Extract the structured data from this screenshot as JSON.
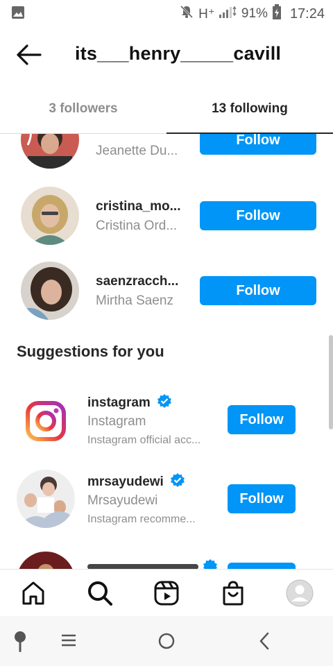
{
  "status_bar": {
    "network": "H⁺",
    "battery": "91%",
    "time": "17:24",
    "icons": [
      "image-icon",
      "mute-icon",
      "signal-icon",
      "battery-icon"
    ]
  },
  "header": {
    "title": "its___henry_____cavill",
    "back_icon": "arrow-left-icon"
  },
  "tabs": [
    {
      "label": "3 followers",
      "active": false
    },
    {
      "label": "13 following",
      "active": true
    }
  ],
  "following": [
    {
      "username": "",
      "name": "Jeanette Du...",
      "button": "Follow"
    },
    {
      "username": "cristina_mo...",
      "name": "Cristina Ord...",
      "button": "Follow"
    },
    {
      "username": "saenzracch...",
      "name": "Mirtha Saenz",
      "button": "Follow"
    }
  ],
  "suggestions": {
    "title": "Suggestions for you",
    "items": [
      {
        "username": "instagram",
        "verified": true,
        "name": "Instagram",
        "description": "Instagram official acc...",
        "button": "Follow"
      },
      {
        "username": "mrsayudewi",
        "verified": true,
        "name": "Mrsayudewi",
        "description": "Instagram recomme...",
        "button": "Follow"
      },
      {
        "verified": true
      }
    ]
  },
  "bottom_nav": [
    "home-icon",
    "search-icon",
    "reels-icon",
    "shop-icon",
    "profile-avatar"
  ],
  "system_nav": [
    "assistant-icon",
    "recents-icon",
    "home-circle-icon",
    "back-chevron-icon"
  ],
  "colors": {
    "accent": "#0095f6",
    "text": "#262626",
    "muted": "#8e8e8e",
    "verified": "#0095f6"
  }
}
